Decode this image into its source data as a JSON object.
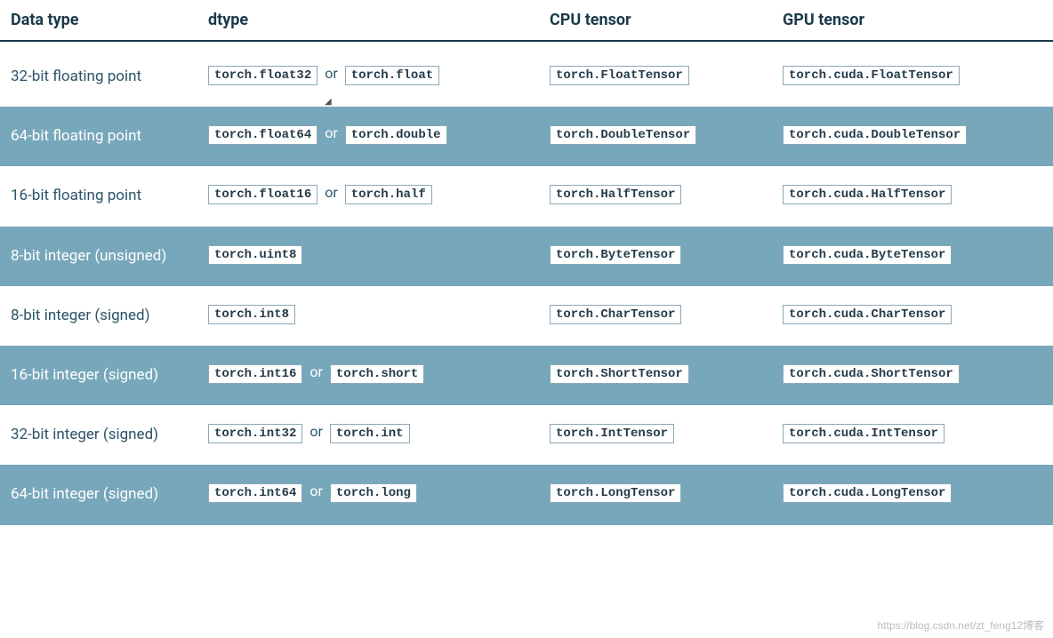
{
  "headers": {
    "c1": "Data type",
    "c2": "dtype",
    "c3": "CPU tensor",
    "c4": "GPU tensor"
  },
  "or_text": "or",
  "rows": [
    {
      "shaded": false,
      "label": "32-bit floating point",
      "dtype_a": "torch.float32",
      "dtype_b": "torch.float",
      "cpu": "torch.FloatTensor",
      "gpu": "torch.cuda.FloatTensor"
    },
    {
      "shaded": true,
      "label": "64-bit floating point",
      "dtype_a": "torch.float64",
      "dtype_b": "torch.double",
      "cpu": "torch.DoubleTensor",
      "gpu": "torch.cuda.DoubleTensor"
    },
    {
      "shaded": false,
      "label": "16-bit floating point",
      "dtype_a": "torch.float16",
      "dtype_b": "torch.half",
      "cpu": "torch.HalfTensor",
      "gpu": "torch.cuda.HalfTensor"
    },
    {
      "shaded": true,
      "label": "8-bit integer (unsigned)",
      "dtype_a": "torch.uint8",
      "dtype_b": null,
      "cpu": "torch.ByteTensor",
      "gpu": "torch.cuda.ByteTensor"
    },
    {
      "shaded": false,
      "label": "8-bit integer (signed)",
      "dtype_a": "torch.int8",
      "dtype_b": null,
      "cpu": "torch.CharTensor",
      "gpu": "torch.cuda.CharTensor"
    },
    {
      "shaded": true,
      "label": "16-bit integer (signed)",
      "dtype_a": "torch.int16",
      "dtype_b": "torch.short",
      "cpu": "torch.ShortTensor",
      "gpu": "torch.cuda.ShortTensor"
    },
    {
      "shaded": false,
      "label": "32-bit integer (signed)",
      "dtype_a": "torch.int32",
      "dtype_b": "torch.int",
      "cpu": "torch.IntTensor",
      "gpu": "torch.cuda.IntTensor"
    },
    {
      "shaded": true,
      "label": "64-bit integer (signed)",
      "dtype_a": "torch.int64",
      "dtype_b": "torch.long",
      "cpu": "torch.LongTensor",
      "gpu": "torch.cuda.LongTensor"
    }
  ],
  "watermark": "https://blog.csdn.net/zt_feng12博客"
}
